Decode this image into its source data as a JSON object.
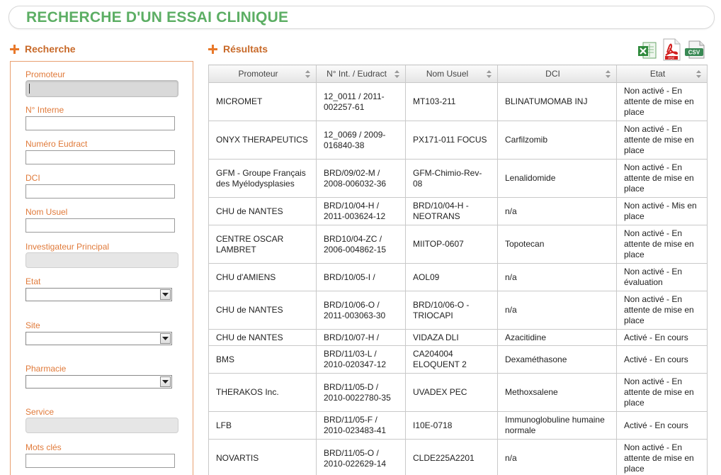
{
  "page": {
    "title": "RECHERCHE D'UN ESSAI CLINIQUE"
  },
  "search": {
    "heading": "Recherche",
    "fields": {
      "promoteur": {
        "label": "Promoteur",
        "value": ""
      },
      "n_interne": {
        "label": "N° Interne",
        "value": ""
      },
      "numero_eudract": {
        "label": "Numéro Eudract",
        "value": ""
      },
      "dci": {
        "label": "DCI",
        "value": ""
      },
      "nom_usuel": {
        "label": "Nom Usuel",
        "value": ""
      },
      "investigateur": {
        "label": "Investigateur Principal",
        "value": ""
      },
      "etat": {
        "label": "Etat",
        "value": ""
      },
      "site": {
        "label": "Site",
        "value": ""
      },
      "pharmacie": {
        "label": "Pharmacie",
        "value": ""
      },
      "service": {
        "label": "Service",
        "value": ""
      },
      "mots_cles": {
        "label": "Mots clés",
        "value": ""
      }
    }
  },
  "results": {
    "heading": "Résultats",
    "exports": {
      "excel": "excel-icon",
      "pdf": "pdf-icon",
      "csv": "csv-icon",
      "pdf_label": "PDF",
      "csv_label": "CSV"
    },
    "columns": [
      "Promoteur",
      "N° Int. / Eudract",
      "Nom Usuel",
      "DCI",
      "Etat"
    ],
    "rows": [
      [
        "MICROMET",
        "12_0011 / 2011-002257-61",
        "MT103-211",
        "BLINATUMOMAB INJ",
        "Non activé - En attente de mise en place"
      ],
      [
        "ONYX THERAPEUTICS",
        "12_0069 / 2009-016840-38",
        "PX171-011 FOCUS",
        "Carfilzomib",
        "Non activé - En attente de mise en place"
      ],
      [
        "GFM - Groupe Français des Myélodysplasies",
        "BRD/09/02-M / 2008-006032-36",
        "GFM-Chimio-Rev-08",
        "Lenalidomide",
        "Non activé - En attente de mise en place"
      ],
      [
        "CHU de NANTES",
        "BRD/10/04-H / 2011-003624-12",
        "BRD/10/04-H - NEOTRANS",
        "n/a",
        "Non activé - Mis en place"
      ],
      [
        "CENTRE OSCAR LAMBRET",
        "BRD10/04-ZC / 2006-004862-15",
        "MIITOP-0607",
        "Topotecan",
        "Non activé - En attente de mise en place"
      ],
      [
        "CHU d'AMIENS",
        "BRD/10/05-I /",
        "AOL09",
        "n/a",
        "Non activé - En évaluation"
      ],
      [
        "CHU de NANTES",
        "BRD/10/06-O / 2011-003063-30",
        "BRD/10/06-O - TRIOCAPI",
        "n/a",
        "Non activé - En attente de mise en place"
      ],
      [
        "CHU de NANTES",
        "BRD/10/07-H /",
        "VIDAZA DLI",
        "Azacitidine",
        "Activé - En cours"
      ],
      [
        "BMS",
        "BRD/11/03-L / 2010-020347-12",
        "CA204004 ELOQUENT 2",
        "Dexaméthasone",
        "Activé - En cours"
      ],
      [
        "THERAKOS Inc.",
        "BRD/11/05-D / 2010-0022780-35",
        "UVADEX PEC",
        "Methoxsalene",
        "Non activé - En attente de mise en place"
      ],
      [
        "LFB",
        "BRD/11/05-F / 2010-023483-41",
        "I10E-0718",
        "Immunoglobuline humaine normale",
        "Activé - En cours"
      ],
      [
        "NOVARTIS",
        "BRD/11/05-O / 2010-022629-14",
        "CLDE225A2201",
        "n/a",
        "Non activé - En attente de mise en place"
      ]
    ]
  }
}
